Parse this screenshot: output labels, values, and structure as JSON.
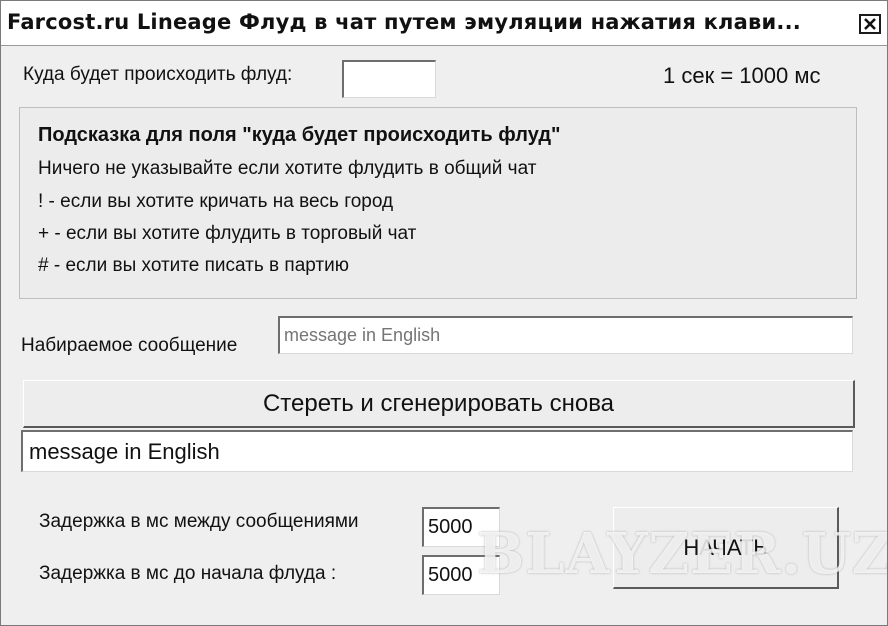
{
  "window": {
    "title": "Farcost.ru Lineage Флуд в чат путем эмуляции нажатия клави...",
    "close_icon": "close-icon"
  },
  "target": {
    "label": "Куда будет происходить флуд:",
    "value": ""
  },
  "time_note": "1 сек = 1000 мс",
  "hint": {
    "title": "Подсказка для поля \"куда будет происходить флуд\"",
    "lines": [
      "Ничего не указывайте если хотите флудить в общий чат",
      "! - если вы хотите кричать на весь город",
      "+ - если вы хотите флудить в торговый чат",
      "# - если вы хотите писать в партию"
    ]
  },
  "message": {
    "label": "Набираемое сообщение",
    "placeholder": "message in English"
  },
  "regenerate_label": "Стереть и сгенерировать снова",
  "generated_message": "message in English",
  "delays": {
    "between_label": "Задержка в мс между сообщениями",
    "between_value": "5000",
    "before_label": "Задержка в мс до начала флуда :",
    "before_value": "5000"
  },
  "start_label": "НАЧАТЬ",
  "watermark": "BLAYZER.UZ",
  "colors": {
    "window_bg": "#efefef",
    "title_bg": "#ffffff",
    "field_bg": "#ffffff"
  }
}
